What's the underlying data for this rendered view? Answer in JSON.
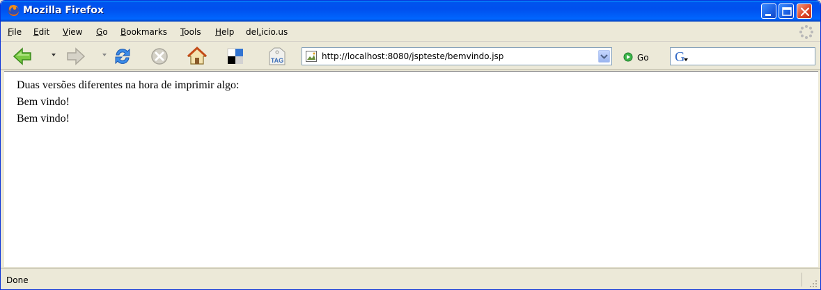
{
  "window": {
    "title": "Mozilla Firefox"
  },
  "menu": {
    "items": [
      {
        "pre": "",
        "ul": "F",
        "post": "ile"
      },
      {
        "pre": "",
        "ul": "E",
        "post": "dit"
      },
      {
        "pre": "",
        "ul": "V",
        "post": "iew"
      },
      {
        "pre": "",
        "ul": "G",
        "post": "o"
      },
      {
        "pre": "",
        "ul": "B",
        "post": "ookmarks"
      },
      {
        "pre": "",
        "ul": "T",
        "post": "ools"
      },
      {
        "pre": "",
        "ul": "H",
        "post": "elp"
      },
      {
        "pre": "del",
        "ul": ".",
        "post": "icio.us"
      }
    ]
  },
  "toolbar": {
    "buttons": [
      "back-icon",
      "forward-icon",
      "reload-icon",
      "stop-icon",
      "home-icon",
      "delicious-icon",
      "tag-icon"
    ],
    "tag_label": "TAG"
  },
  "address": {
    "url": "http://localhost:8080/jspteste/bemvindo.jsp",
    "go_label": "Go"
  },
  "content": {
    "lines": [
      "Duas versões diferentes na hora de imprimir algo:",
      "Bem vindo!",
      "Bem vindo!"
    ]
  },
  "status": {
    "text": "Done"
  },
  "colors": {
    "titlebar": "#0053ee",
    "close_button": "#e0482a",
    "chrome": "#ece9d8"
  }
}
